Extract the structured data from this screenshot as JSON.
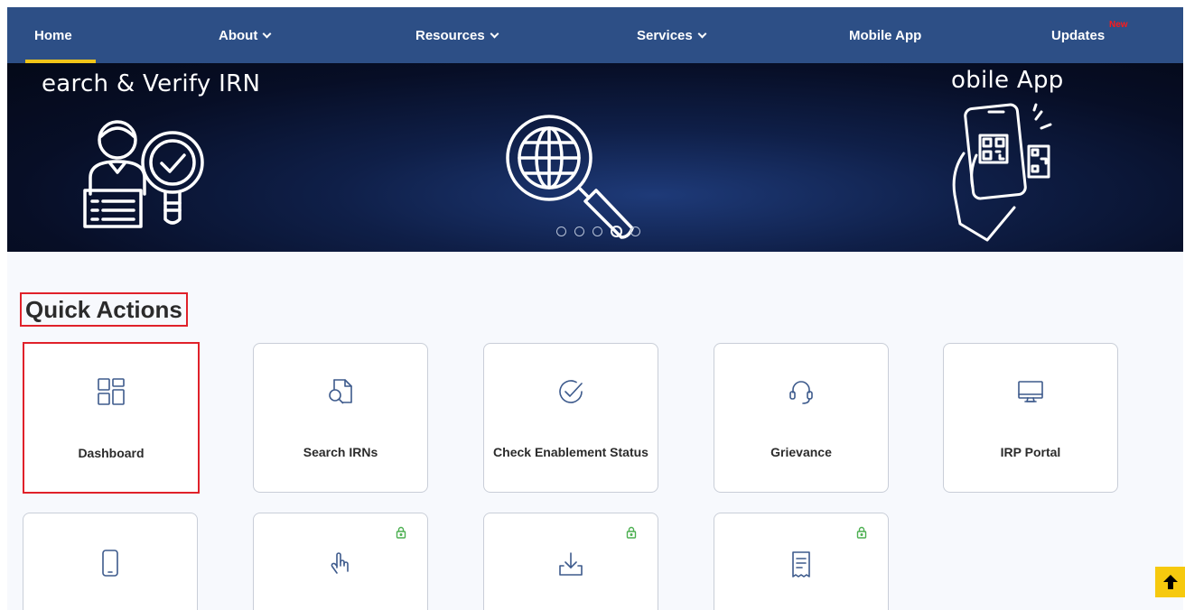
{
  "nav": {
    "items": [
      {
        "label": "Home",
        "has_dropdown": false,
        "active": true
      },
      {
        "label": "About",
        "has_dropdown": true
      },
      {
        "label": "Resources",
        "has_dropdown": true
      },
      {
        "label": "Services",
        "has_dropdown": true
      },
      {
        "label": "Mobile App",
        "has_dropdown": false
      },
      {
        "label": "Updates",
        "has_dropdown": false,
        "badge": "New"
      }
    ],
    "bg_color": "#2d4f86",
    "active_underline_color": "#f0c419"
  },
  "banner": {
    "left_caption": "earch & Verify IRN",
    "right_caption": "obile App",
    "slide_count": 5,
    "active_slide": 4
  },
  "quick_actions": {
    "title": "Quick Actions",
    "cards": [
      {
        "label": "Dashboard",
        "icon": "dashboard-grid-icon",
        "highlighted": true
      },
      {
        "label": "Search IRNs",
        "icon": "search-document-icon"
      },
      {
        "label": "Check Enablement Status",
        "icon": "check-circle-icon"
      },
      {
        "label": "Grievance",
        "icon": "headset-icon"
      },
      {
        "label": "IRP Portal",
        "icon": "monitor-icon"
      },
      {
        "label": "",
        "icon": "mobile-phone-icon",
        "locked": false
      },
      {
        "label": "",
        "icon": "hand-pointer-icon",
        "locked": true
      },
      {
        "label": "",
        "icon": "download-icon",
        "locked": true
      },
      {
        "label": "",
        "icon": "receipt-icon",
        "locked": true
      }
    ]
  },
  "colors": {
    "highlight": "#e0212a",
    "icon": "#3d5a8c",
    "lock": "#4caf50",
    "scroll_top": "#f6c90e"
  },
  "scroll_top": {
    "icon": "arrow-up-icon"
  }
}
